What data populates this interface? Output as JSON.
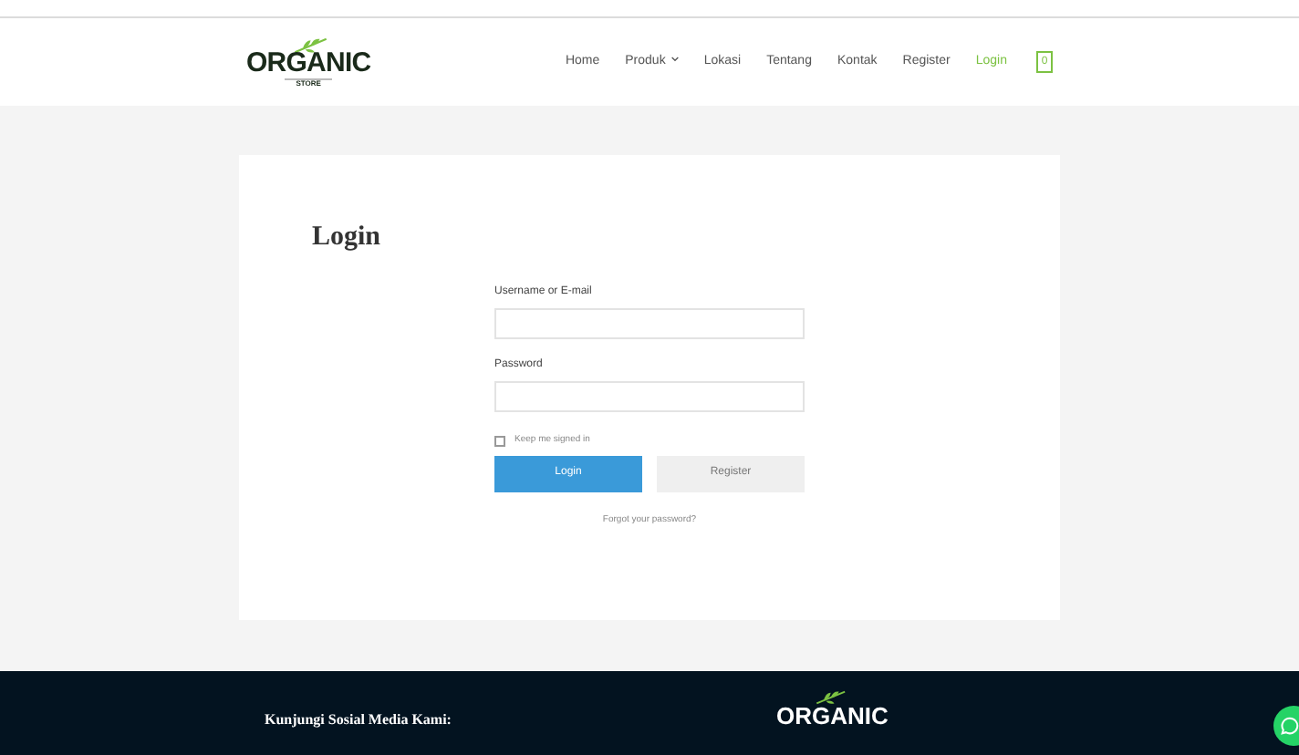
{
  "logo": {
    "title": "ORGANIC",
    "subtitle": "STORE"
  },
  "nav": [
    {
      "label": "Home",
      "selected": false,
      "dropdown": false
    },
    {
      "label": "Produk",
      "selected": false,
      "dropdown": true
    },
    {
      "label": "Lokasi",
      "selected": false,
      "dropdown": false
    },
    {
      "label": "Tentang",
      "selected": false,
      "dropdown": false
    },
    {
      "label": "Kontak",
      "selected": false,
      "dropdown": false
    },
    {
      "label": "Register",
      "selected": false,
      "dropdown": false
    },
    {
      "label": "Login",
      "selected": true,
      "dropdown": false
    }
  ],
  "cart": {
    "count": "0"
  },
  "login": {
    "title": "Login",
    "username_label": "Username or E-mail",
    "password_label": "Password",
    "remember": {
      "label": "Keep me signed in",
      "checked": false
    },
    "login_button": "Login",
    "register_button": "Register",
    "forgot_link": "Forgot your password?"
  },
  "footer": {
    "heading": "Kunjungi Sosial Media Kami:",
    "logo_title": "ORGANIC"
  }
}
